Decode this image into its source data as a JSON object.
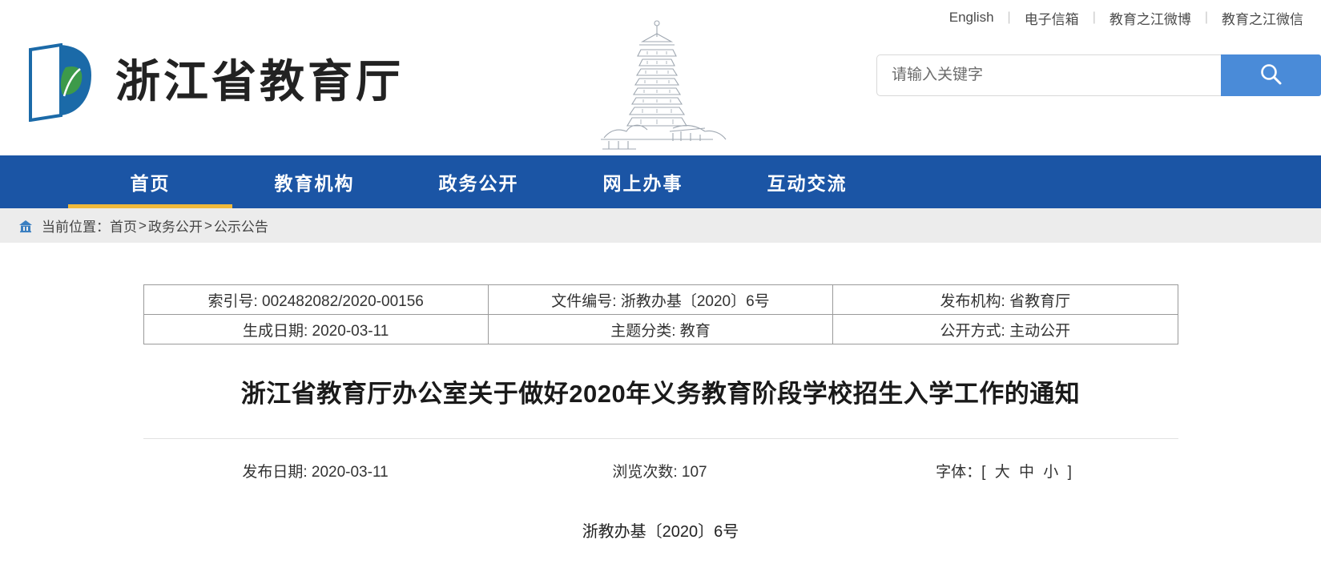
{
  "topbar": {
    "links": [
      {
        "label": "English"
      },
      {
        "label": "电子信箱"
      },
      {
        "label": "教育之江微博"
      },
      {
        "label": "教育之江微信"
      }
    ],
    "separator": "|"
  },
  "header": {
    "site_title": "浙江省教育厅",
    "logo_colors": {
      "book": "#1b6aa8",
      "leaf": "#3d9a4a"
    },
    "search": {
      "placeholder": "请输入关键字",
      "value": "",
      "button_icon": "search-icon",
      "button_color": "#4a8bd8"
    }
  },
  "nav": {
    "active_index": 0,
    "bg_color": "#1b55a5",
    "active_underline_color": "#f0b93a",
    "items": [
      {
        "label": "首页"
      },
      {
        "label": "教育机构"
      },
      {
        "label": "政务公开"
      },
      {
        "label": "网上办事"
      },
      {
        "label": "互动交流"
      }
    ]
  },
  "breadcrumb": {
    "home_icon": "home-icon",
    "prefix": "当前位置：",
    "items": [
      {
        "label": "首页"
      },
      {
        "label": "政务公开"
      },
      {
        "label": "公示公告"
      }
    ],
    "separator": ">"
  },
  "meta_table": {
    "rows": [
      [
        {
          "label": "索引号:",
          "value": "002482082/2020-00156"
        },
        {
          "label": "文件编号:",
          "value": "浙教办基〔2020〕6号"
        },
        {
          "label": "发布机构:",
          "value": "省教育厅"
        }
      ],
      [
        {
          "label": "生成日期:",
          "value": "2020-03-11"
        },
        {
          "label": "主题分类:",
          "value": "教育"
        },
        {
          "label": "公开方式:",
          "value": "主动公开"
        }
      ]
    ]
  },
  "document": {
    "title": "浙江省教育厅办公室关于做好2020年义务教育阶段学校招生入学工作的通知",
    "publish_label": "发布日期:",
    "publish_date": "2020-03-11",
    "views_label": "浏览次数:",
    "views_count": "107",
    "font_label": "字体：",
    "font_bracket_open": "[",
    "font_bracket_close": "]",
    "font_sizes": [
      {
        "label": "大"
      },
      {
        "label": "中"
      },
      {
        "label": "小"
      }
    ],
    "doc_number": "浙教办基〔2020〕6号"
  }
}
